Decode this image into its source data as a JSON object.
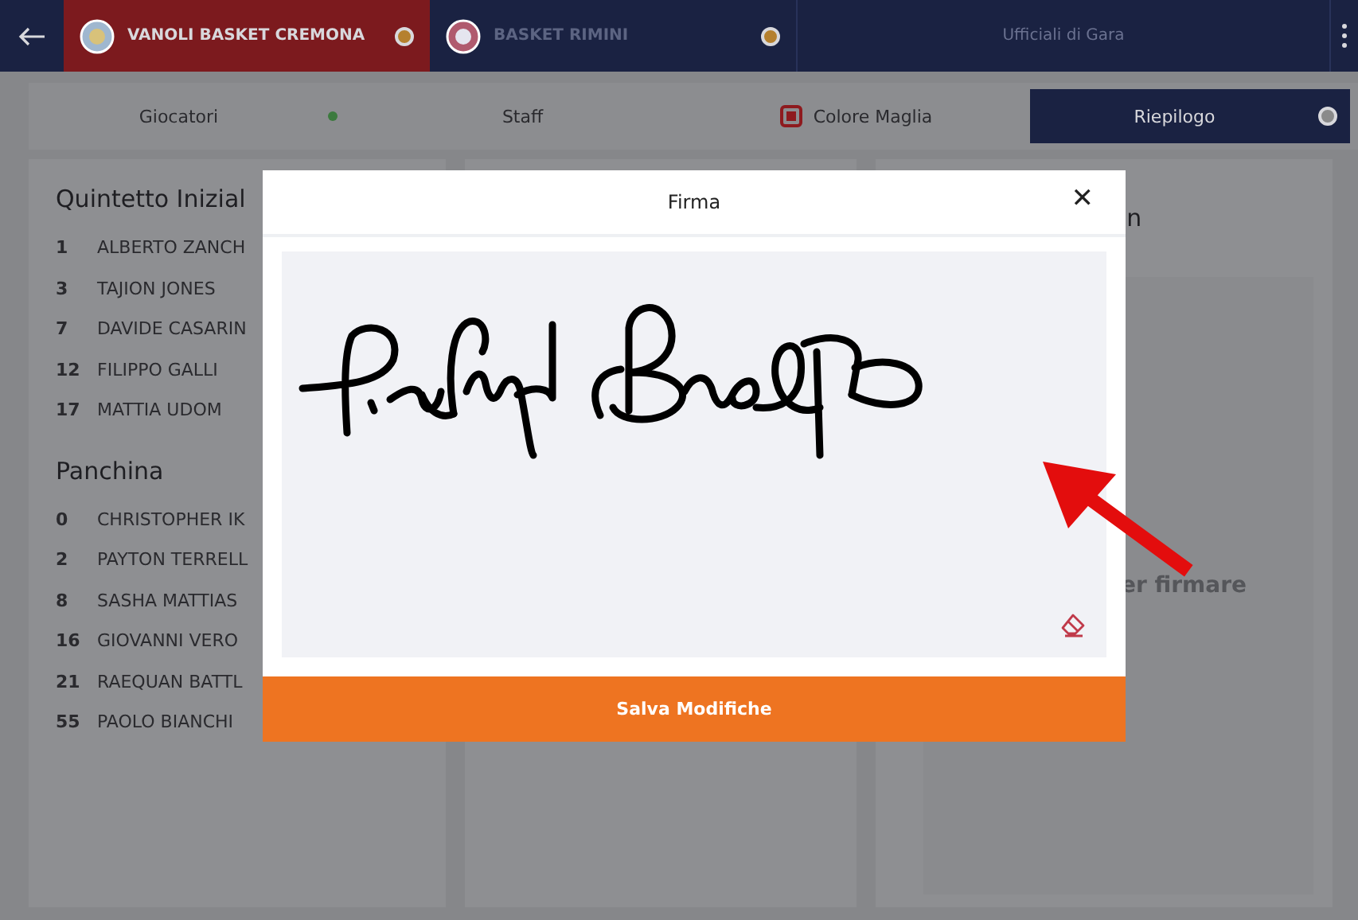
{
  "top_tabs": [
    {
      "kind": "team",
      "label": "VANOLI BASKET CREMONA",
      "selected": true,
      "color": "#b5802e"
    },
    {
      "kind": "team",
      "label": "BASKET RIMINI",
      "selected": false,
      "color": "#b5802e"
    },
    {
      "kind": "plain",
      "label": "Ufficiali di Gara",
      "selected": false
    }
  ],
  "sub_tabs": [
    {
      "kind": "dot",
      "label": "Giocatori",
      "selected": false,
      "color": "#3c7a3e"
    },
    {
      "kind": "plain",
      "label": "Staff",
      "selected": false
    },
    {
      "kind": "jersey",
      "label": "Colore Maglia",
      "selected": false,
      "color": "#8e1a1e"
    },
    {
      "kind": "dot",
      "label": "Riepilogo",
      "selected": true,
      "color": "#8a8a8a"
    }
  ],
  "roster": {
    "sections": [
      {
        "title": "Quintetto Inizial",
        "players": [
          {
            "number": "1",
            "name": "ALBERTO ZANCH"
          },
          {
            "number": "3",
            "name": "TAJION JONES"
          },
          {
            "number": "7",
            "name": "DAVIDE CASARIN"
          },
          {
            "number": "12",
            "name": "FILIPPO GALLI"
          },
          {
            "number": "17",
            "name": "MATTIA UDOM"
          }
        ]
      },
      {
        "title": "Panchina",
        "players": [
          {
            "number": "0",
            "name": "CHRISTOPHER IK"
          },
          {
            "number": "2",
            "name": "PAYTON TERRELL"
          },
          {
            "number": "8",
            "name": "SASHA MATTIAS"
          },
          {
            "number": "16",
            "name": "GIOVANNI VERO"
          },
          {
            "number": "21",
            "name": "RAEQUAN BATTL"
          },
          {
            "number": "55",
            "name": "PAOLO BIANCHI"
          }
        ]
      }
    ]
  },
  "signature_panel": {
    "title": "n",
    "hint": "er firmare"
  },
  "dialog": {
    "title": "Firma",
    "close": "✕",
    "save_button": "Salva Modifiche"
  }
}
